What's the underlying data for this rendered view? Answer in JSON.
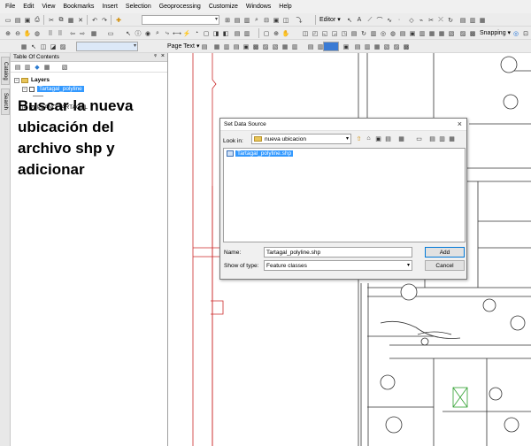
{
  "menu": [
    "File",
    "Edit",
    "View",
    "Bookmarks",
    "Insert",
    "Selection",
    "Geoprocessing",
    "Customize",
    "Windows",
    "Help"
  ],
  "toolbar": {
    "editor_label": "Editor",
    "page_text_label": "Page Text",
    "snapping_label": "Snapping",
    "scale_value": ""
  },
  "side_tabs": [
    "Catalog",
    "Search"
  ],
  "toc": {
    "title": "Table Of Contents",
    "root": "Layers",
    "layers": [
      {
        "name": "Tartagal_polyline",
        "checked": false,
        "selected": true
      },
      {
        "name": "PLANO TARTAGAL",
        "checked": true,
        "selected": false
      }
    ]
  },
  "instruction": "Buscar la nueva ubicación del archivo shp y adicionar",
  "dialog": {
    "title": "Set Data Source",
    "look_in_label": "Look in:",
    "look_in_value": "nueva ubicacion",
    "files": [
      "Tartagal_polyline.shp"
    ],
    "name_label": "Name:",
    "name_value": "Tartagal_polyline.shp",
    "type_label": "Show of type:",
    "type_value": "Feature classes",
    "add_label": "Add",
    "cancel_label": "Cancel"
  },
  "colors": {
    "selection": "#3399ff",
    "map_red": "#cc2a2a",
    "map_line": "#333333"
  }
}
